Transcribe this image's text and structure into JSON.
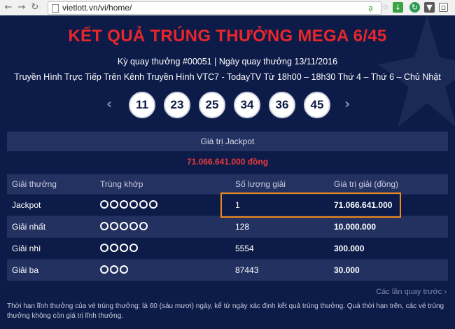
{
  "browser": {
    "url": "vietlott.vn/vi/home/",
    "icons": [
      "back-arrow-icon",
      "forward-arrow-icon",
      "reload-icon",
      "home-icon",
      "page-icon",
      "extension-a-icon",
      "bookmark-star-icon",
      "download-icon",
      "refresh-green-icon",
      "pocket-icon",
      "chat-icon",
      "menu-icon"
    ]
  },
  "header": {
    "title": "KẾT QUẢ TRÚNG THƯỞNG MEGA 6/45",
    "draw_info": "Kỳ quay thưởng #00051 | Ngày quay thưởng 13/11/2016",
    "broadcast": "Truyền Hình Trực Tiếp Trên Kênh Truyền Hình VTC7 - TodayTV Từ 18h00 – 18h30 Thứ 4 – Thứ 6 – Chủ Nhật"
  },
  "numbers": [
    "11",
    "23",
    "25",
    "34",
    "36",
    "45"
  ],
  "jackpot": {
    "label": "Giá trị Jackpot",
    "value": "71.066.641.000 đồng"
  },
  "table": {
    "headers": [
      "Giải thưởng",
      "Trùng khớp",
      "Số lượng giải",
      "Giá trị giải (đồng)"
    ],
    "rows": [
      {
        "prize": "Jackpot",
        "match_count": 6,
        "winners": "1",
        "value": "71.066.641.000"
      },
      {
        "prize": "Giải nhất",
        "match_count": 5,
        "winners": "128",
        "value": "10.000.000"
      },
      {
        "prize": "Giải nhì",
        "match_count": 4,
        "winners": "5554",
        "value": "300.000"
      },
      {
        "prize": "Giải ba",
        "match_count": 3,
        "winners": "87443",
        "value": "30.000"
      }
    ]
  },
  "history_link": "Các lần quay trước ›",
  "footer_note": "Thời hạn lĩnh thưởng của vé trúng thưởng: là 60 (sáu mươi) ngày, kể từ ngày xác định kết quả trúng thưởng. Quá thời hạn trên, các vé trúng thưởng không còn giá trị lĩnh thưởng.",
  "colors": {
    "background": "#0d1b48",
    "title_red": "#e8262b",
    "highlight_orange": "#f08a1c"
  }
}
